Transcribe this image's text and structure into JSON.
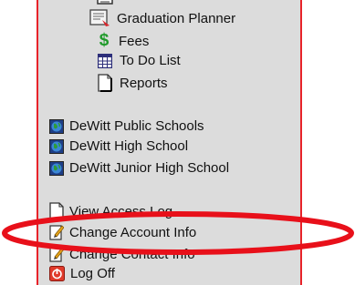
{
  "menu": {
    "planner_items": [
      {
        "label": "Graduation Planner",
        "icon": "graduation-planner-icon"
      },
      {
        "label": "Fees",
        "icon": "dollar-icon"
      },
      {
        "label": "To Do List",
        "icon": "calendar-grid-icon"
      },
      {
        "label": "Reports",
        "icon": "page-icon"
      }
    ],
    "schools": [
      {
        "label": "DeWitt Public Schools",
        "icon": "globe-icon"
      },
      {
        "label": "DeWitt High School",
        "icon": "globe-icon"
      },
      {
        "label": "DeWitt Junior High School",
        "icon": "globe-icon"
      }
    ],
    "account": [
      {
        "label": "View Access Log",
        "icon": "page-icon"
      },
      {
        "label": "Change Account Info",
        "icon": "edit-icon"
      },
      {
        "label": "Change Contact Info",
        "icon": "edit-icon"
      },
      {
        "label": "Log Off",
        "icon": "power-icon"
      }
    ]
  },
  "colors": {
    "panel_bg": "#dcdcdc",
    "panel_border": "#e8232a",
    "highlight_oval": "#e8101a"
  }
}
